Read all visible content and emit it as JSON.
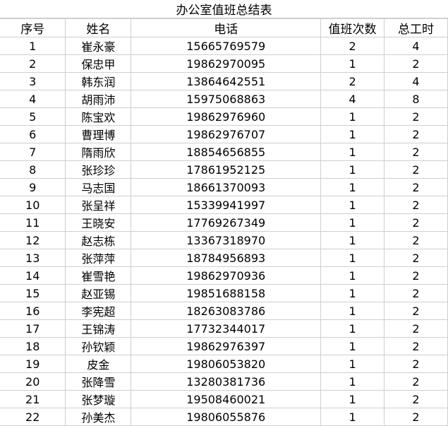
{
  "sheet": {
    "title": "办公室值班总结表",
    "columns": [
      "序号",
      "姓名",
      "电话",
      "值班次数",
      "总工时"
    ],
    "rows": [
      [
        "1",
        "崔永豪",
        "15665769579",
        "2",
        "4"
      ],
      [
        "2",
        "保忠甲",
        "19862970095",
        "1",
        "2"
      ],
      [
        "3",
        "韩东润",
        "13864642551",
        "2",
        "4"
      ],
      [
        "4",
        "胡雨沛",
        "15975068863",
        "4",
        "8"
      ],
      [
        "5",
        "陈宝欢",
        "19862976960",
        "1",
        "2"
      ],
      [
        "6",
        "曹理博",
        "19862976707",
        "1",
        "2"
      ],
      [
        "7",
        "隋雨欣",
        "18854656855",
        "1",
        "2"
      ],
      [
        "8",
        "张珍珍",
        "17861952125",
        "1",
        "2"
      ],
      [
        "9",
        "马志国",
        "18661370093",
        "1",
        "2"
      ],
      [
        "10",
        "张呈祥",
        "15339941997",
        "1",
        "2"
      ],
      [
        "11",
        "王晓安",
        "17769267349",
        "1",
        "2"
      ],
      [
        "12",
        "赵志栋",
        "13367318970",
        "1",
        "2"
      ],
      [
        "13",
        "张萍萍",
        "18784956893",
        "1",
        "2"
      ],
      [
        "14",
        "崔雪艳",
        "19862970936",
        "1",
        "2"
      ],
      [
        "15",
        "赵亚锡",
        "19851688158",
        "1",
        "2"
      ],
      [
        "16",
        "李宪超",
        "18263083786",
        "1",
        "2"
      ],
      [
        "17",
        "王锦涛",
        "17732344017",
        "1",
        "2"
      ],
      [
        "18",
        "孙钦颖",
        "19862976397",
        "1",
        "2"
      ],
      [
        "19",
        "皮金",
        "19806053820",
        "1",
        "2"
      ],
      [
        "20",
        "张降雪",
        "13280381736",
        "1",
        "2"
      ],
      [
        "21",
        "张梦璇",
        "19508460021",
        "1",
        "2"
      ],
      [
        "22",
        "孙美杰",
        "19806055876",
        "1",
        "2"
      ]
    ]
  }
}
